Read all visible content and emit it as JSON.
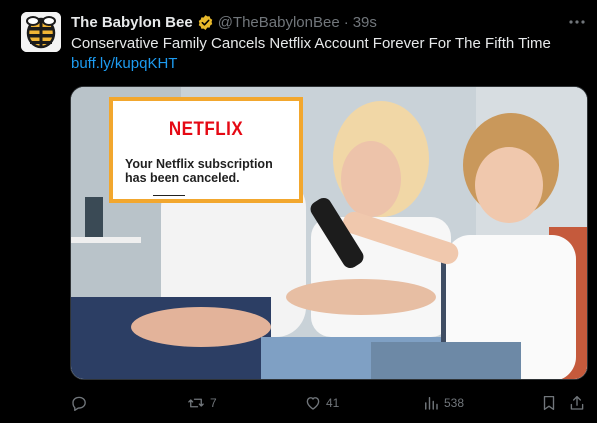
{
  "tweet": {
    "author_name": "The Babylon Bee",
    "handle": "@TheBabylonBee",
    "separator": "·",
    "time": "39s",
    "text": "Conservative Family Cancels Netflix Account Forever For The Fifth Time",
    "link": "buff.ly/kupqKHT"
  },
  "media": {
    "popup_brand": "NETFLIX",
    "popup_message": "Your Netflix subscription has been canceled."
  },
  "actions": {
    "reply_count": "",
    "repost_count": "7",
    "like_count": "41",
    "views_count": "538"
  },
  "colors": {
    "background": "#000000",
    "text": "#e7e9ea",
    "muted": "#71767b",
    "link": "#1d9bf0",
    "verified_gold": "#e8b92b",
    "netflix_red": "#e50914",
    "popup_border": "#f2a72e"
  },
  "icons": [
    "bee-logo-icon",
    "verified-badge-icon",
    "more-options-icon",
    "reply-icon",
    "repost-icon",
    "like-icon",
    "views-icon",
    "bookmark-icon",
    "share-icon"
  ]
}
